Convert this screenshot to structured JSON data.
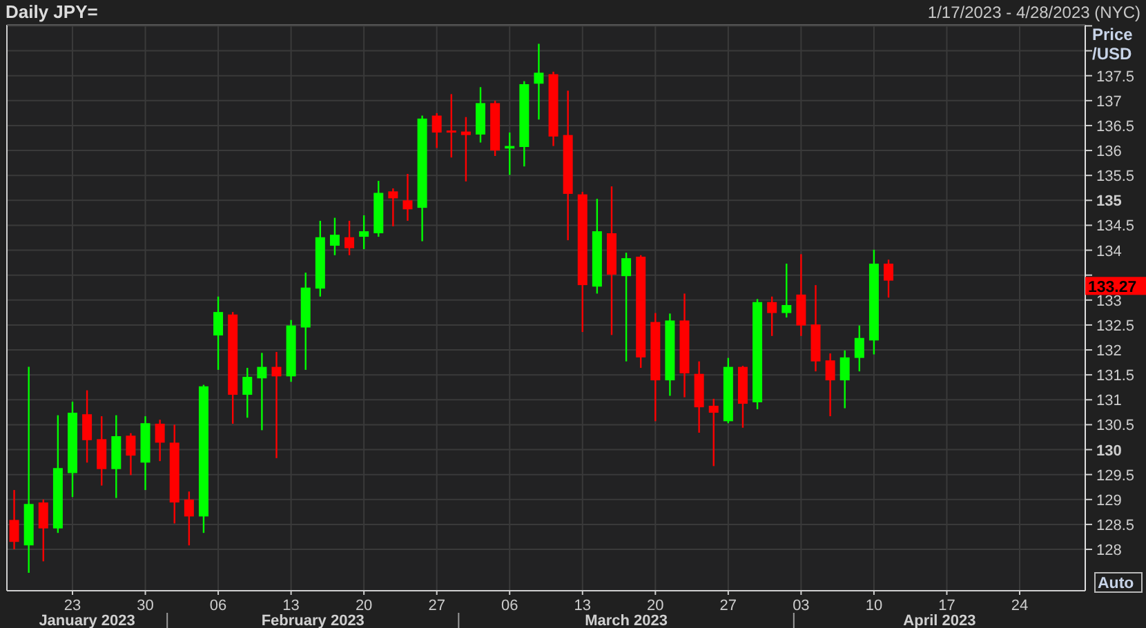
{
  "header": {
    "title": "Daily JPY=",
    "date_range": "1/17/2023 - 4/28/2023 (NYC)"
  },
  "price_axis": {
    "title_lines": [
      "Price",
      "/USD"
    ],
    "last_price": "133.27",
    "auto_button": "Auto"
  },
  "month_labels": [
    "January 2023",
    "February 2023",
    "March 2023",
    "April 2023"
  ],
  "chart_data": {
    "type": "candlestick",
    "categories": [
      null,
      null,
      null,
      null,
      "23",
      null,
      null,
      null,
      null,
      "30",
      null,
      null,
      null,
      null,
      "06",
      null,
      null,
      null,
      null,
      "13",
      null,
      null,
      null,
      null,
      "20",
      null,
      null,
      null,
      null,
      "27",
      null,
      null,
      null,
      null,
      "06",
      null,
      null,
      null,
      null,
      "13",
      null,
      null,
      null,
      null,
      "20",
      null,
      null,
      null,
      null,
      "27",
      null,
      null,
      null,
      null,
      "03",
      null,
      null,
      null,
      null,
      "10",
      null,
      null,
      null,
      null,
      "17",
      null,
      null,
      null,
      null,
      "24",
      null,
      null,
      null,
      null
    ],
    "ohlc": [
      [
        128.59,
        129.19,
        128.0,
        128.15
      ],
      [
        128.08,
        131.66,
        127.53,
        128.91
      ],
      [
        128.94,
        129.0,
        127.76,
        128.42
      ],
      [
        128.42,
        130.69,
        128.33,
        129.63
      ],
      [
        129.53,
        130.96,
        129.05,
        130.74
      ],
      [
        130.71,
        131.19,
        129.74,
        130.19
      ],
      [
        130.21,
        130.67,
        129.28,
        129.61
      ],
      [
        129.61,
        130.69,
        129.03,
        130.27
      ],
      [
        130.28,
        130.33,
        129.49,
        129.88
      ],
      [
        129.74,
        130.67,
        129.19,
        130.53
      ],
      [
        130.52,
        130.6,
        129.77,
        130.14
      ],
      [
        130.14,
        130.5,
        128.52,
        128.94
      ],
      [
        129.0,
        129.16,
        128.08,
        128.66
      ],
      [
        128.66,
        131.3,
        128.33,
        131.27
      ],
      [
        132.29,
        133.07,
        131.6,
        132.76
      ],
      [
        132.71,
        132.76,
        130.52,
        131.1
      ],
      [
        131.1,
        131.64,
        130.64,
        131.46
      ],
      [
        131.43,
        131.94,
        130.39,
        131.66
      ],
      [
        131.66,
        131.96,
        129.83,
        131.47
      ],
      [
        131.47,
        132.6,
        131.36,
        132.49
      ],
      [
        132.45,
        133.55,
        131.6,
        133.25
      ],
      [
        133.23,
        134.59,
        133.07,
        134.26
      ],
      [
        134.09,
        134.65,
        133.9,
        134.31
      ],
      [
        134.26,
        134.59,
        133.9,
        134.04
      ],
      [
        134.27,
        134.7,
        134.02,
        134.38
      ],
      [
        134.34,
        135.39,
        134.27,
        135.15
      ],
      [
        135.18,
        135.24,
        134.48,
        135.04
      ],
      [
        135.0,
        135.53,
        134.59,
        134.82
      ],
      [
        134.85,
        136.7,
        134.18,
        136.64
      ],
      [
        136.7,
        136.75,
        136.05,
        136.36
      ],
      [
        136.39,
        137.13,
        135.86,
        136.37
      ],
      [
        136.38,
        136.67,
        135.38,
        136.31
      ],
      [
        136.32,
        137.27,
        136.16,
        136.95
      ],
      [
        136.95,
        137.0,
        135.89,
        136.0
      ],
      [
        136.04,
        136.36,
        135.51,
        136.09
      ],
      [
        136.07,
        137.39,
        135.68,
        137.33
      ],
      [
        137.34,
        138.14,
        136.62,
        137.56
      ],
      [
        137.53,
        137.58,
        136.09,
        136.28
      ],
      [
        136.31,
        137.2,
        134.2,
        135.13
      ],
      [
        135.12,
        135.17,
        132.36,
        133.3
      ],
      [
        133.27,
        135.03,
        133.13,
        134.38
      ],
      [
        134.34,
        135.28,
        132.3,
        133.51
      ],
      [
        133.48,
        133.95,
        131.77,
        133.84
      ],
      [
        133.87,
        133.9,
        131.64,
        131.85
      ],
      [
        132.56,
        132.74,
        130.57,
        131.39
      ],
      [
        131.39,
        132.73,
        131.08,
        132.59
      ],
      [
        132.59,
        133.13,
        131.05,
        131.53
      ],
      [
        131.52,
        131.77,
        130.34,
        130.85
      ],
      [
        130.88,
        131.02,
        129.67,
        130.74
      ],
      [
        130.57,
        131.84,
        130.53,
        131.66
      ],
      [
        131.66,
        131.68,
        130.44,
        130.92
      ],
      [
        130.95,
        133.02,
        130.81,
        132.96
      ],
      [
        132.96,
        133.07,
        132.28,
        132.74
      ],
      [
        132.74,
        133.73,
        132.65,
        132.9
      ],
      [
        133.11,
        133.92,
        132.28,
        132.49
      ],
      [
        132.51,
        133.3,
        131.57,
        131.77
      ],
      [
        131.79,
        131.93,
        130.67,
        131.39
      ],
      [
        131.39,
        131.99,
        130.83,
        131.85
      ],
      [
        131.84,
        132.49,
        131.57,
        132.24
      ],
      [
        132.19,
        134.01,
        131.91,
        133.73
      ],
      [
        133.73,
        133.81,
        133.05,
        133.39
      ],
      null,
      null,
      null,
      null,
      null,
      null,
      null,
      null,
      null,
      null,
      null,
      null,
      null
    ],
    "ylim": [
      127.17,
      138.52
    ],
    "grid": true,
    "yticks": [
      128,
      128.5,
      129,
      129.5,
      130,
      130.5,
      131,
      131.5,
      132,
      132.5,
      133,
      134,
      134.5,
      135,
      135.5,
      136,
      136.5,
      137,
      137.5
    ]
  }
}
